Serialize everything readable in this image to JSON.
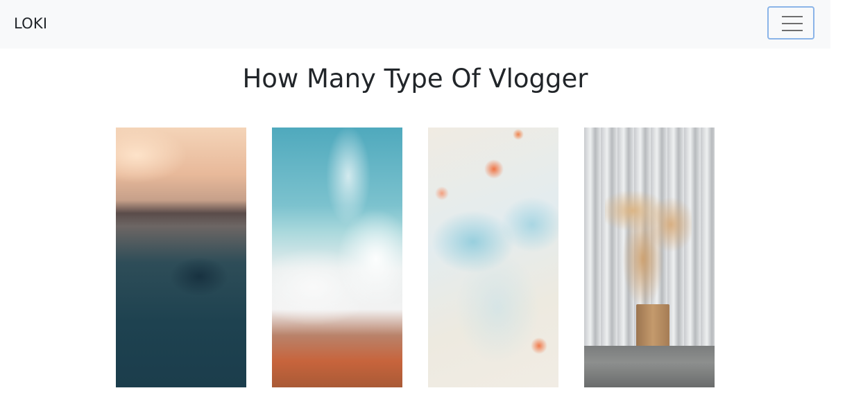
{
  "navbar": {
    "brand": "LOKI",
    "toggler_icon": "hamburger-menu-icon"
  },
  "main": {
    "title": "How Many Type Of Vlogger",
    "gallery": [
      {
        "subject": "sea-splash-image"
      },
      {
        "subject": "wave-splash-image"
      },
      {
        "subject": "paint-swirl-image"
      },
      {
        "subject": "coffee-splash-image"
      }
    ]
  },
  "colors": {
    "navbar_bg": "#f8f9fa",
    "toggler_border": "#8ab4e8",
    "text": "#212529"
  }
}
